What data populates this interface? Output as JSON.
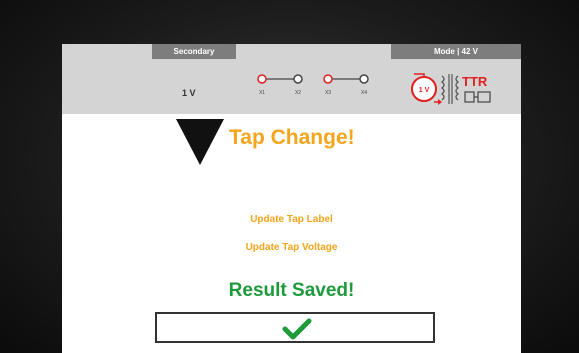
{
  "header": {
    "secondary_tab": "Secondary",
    "mode_tab": "Mode | 42 V",
    "voltage": "1 V",
    "terminals": [
      "X1",
      "X2",
      "X3",
      "X4"
    ],
    "ttr_label": "TTR",
    "ttr_coil_label": "1 V"
  },
  "main": {
    "title": "Tap Change!",
    "update_tap_label": "Update Tap Label",
    "update_tap_voltage": "Update Tap Voltage",
    "result": "Result Saved!"
  },
  "colors": {
    "accent_orange": "#f3a51c",
    "success_green": "#1e9a3a",
    "terminal_red": "#e02020",
    "header_gray": "#d4d4d4"
  },
  "icons": [
    "down-triangle-icon",
    "ttr-transformer-icon",
    "checkmark-icon"
  ]
}
